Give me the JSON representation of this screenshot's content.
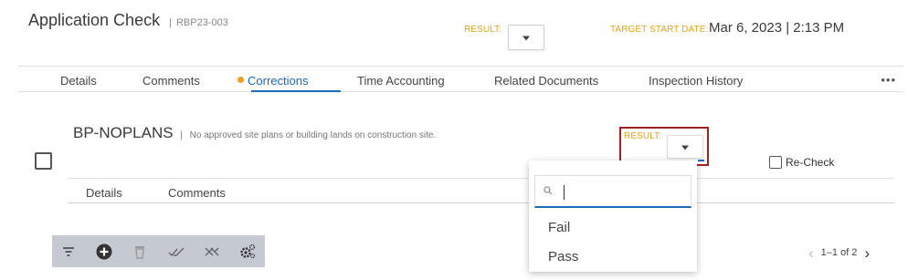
{
  "header": {
    "title": "Application Check",
    "separator": "|",
    "record_id": "RBP23-003",
    "result_label": "RESULT:",
    "target_label": "TARGET START DATE:",
    "target_value": "Mar 6, 2023 | 2:13 PM"
  },
  "tabs": [
    {
      "label": "Details"
    },
    {
      "label": "Comments"
    },
    {
      "label": "Corrections",
      "active": true
    },
    {
      "label": "Time Accounting"
    },
    {
      "label": "Related Documents"
    },
    {
      "label": "Inspection History"
    }
  ],
  "more_label": "•••",
  "check_item": {
    "code": "BP-NOPLANS",
    "separator": "|",
    "description": "No approved site plans or building lands on construction site.",
    "result_label": "RESULT:",
    "recheck_label": "Re-Check",
    "subtabs": [
      "Details",
      "Comments"
    ]
  },
  "dropdown": {
    "search_value": "",
    "options": [
      "Fail",
      "Pass"
    ]
  },
  "toolbar": {
    "icons": [
      "filter-icon",
      "add-circle-icon",
      "trash-icon",
      "double-check-icon",
      "double-x-icon",
      "settings-gear-icon"
    ]
  },
  "pager": {
    "text": "1–1 of 2",
    "prev": "‹",
    "next": "›"
  },
  "colors": {
    "accent": "#1a6bb8",
    "orange": "#e8a317",
    "highlight_border": "#a52020",
    "toolbar_bg": "#c5cad2"
  }
}
